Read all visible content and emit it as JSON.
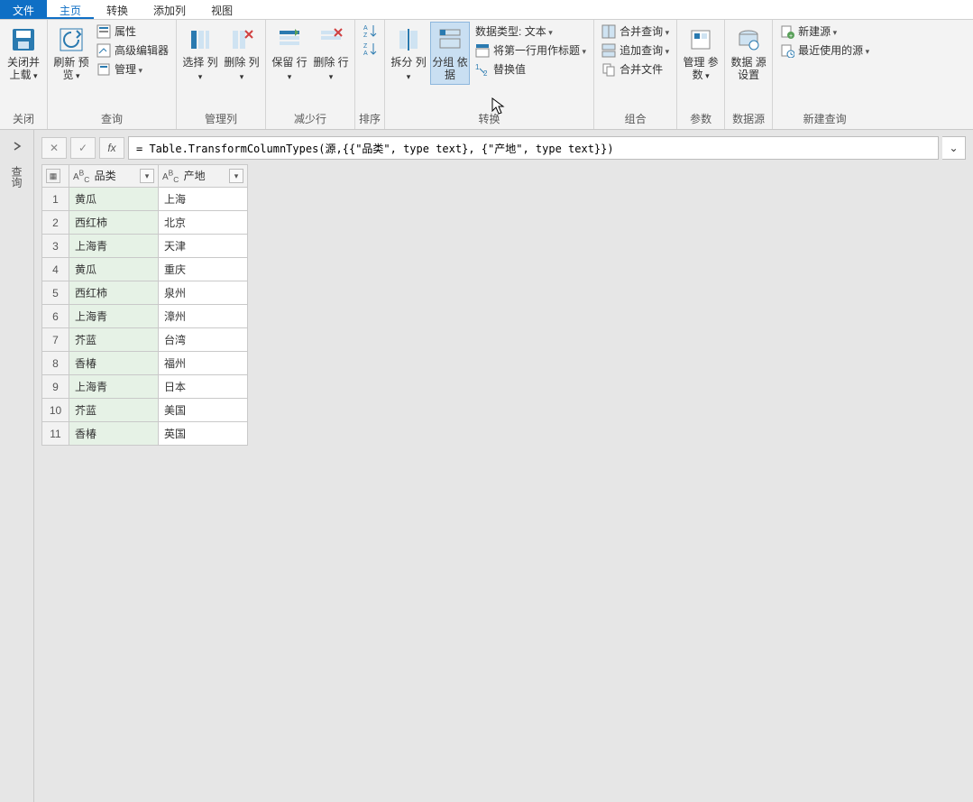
{
  "tabs": {
    "file": "文件",
    "home": "主页",
    "transform": "转换",
    "add_column": "添加列",
    "view": "视图"
  },
  "ribbon": {
    "close": {
      "close_load": "关闭并\n上载",
      "group": "关闭"
    },
    "query": {
      "refresh": "刷新\n预览",
      "properties": "属性",
      "adv_editor": "高级编辑器",
      "manage": "管理",
      "group": "查询"
    },
    "manage_cols": {
      "choose": "选择\n列",
      "remove": "删除\n列",
      "group": "管理列"
    },
    "reduce_rows": {
      "keep": "保留\n行",
      "remove": "删除\n行",
      "group": "减少行"
    },
    "sort": {
      "group": "排序"
    },
    "split_group": {
      "split": "拆分\n列",
      "groupby": "分组\n依据",
      "group": "转换"
    },
    "transform": {
      "datatype_label": "数据类型:",
      "datatype_value": "文本",
      "first_row": "将第一行用作标题",
      "replace": "替换值"
    },
    "combine": {
      "merge": "合并查询",
      "append": "追加查询",
      "combine_files": "合并文件",
      "group": "组合"
    },
    "params": {
      "label": "管理\n参数",
      "group": "参数"
    },
    "datasource": {
      "label": "数据\n源设置",
      "group": "数据源"
    },
    "newquery": {
      "new_source": "新建源",
      "recent": "最近使用的源",
      "group": "新建查询"
    }
  },
  "rail": {
    "label": "查询"
  },
  "formula": {
    "text": "= Table.TransformColumnTypes(源,{{\"品类\", type text}, {\"产地\", type text}})"
  },
  "columns": [
    "品类",
    "产地"
  ],
  "rows": [
    {
      "n": "1",
      "c0": "黄瓜",
      "c1": "上海"
    },
    {
      "n": "2",
      "c0": "西红柿",
      "c1": "北京"
    },
    {
      "n": "3",
      "c0": "上海青",
      "c1": "天津"
    },
    {
      "n": "4",
      "c0": "黄瓜",
      "c1": "重庆"
    },
    {
      "n": "5",
      "c0": "西红柿",
      "c1": "泉州"
    },
    {
      "n": "6",
      "c0": "上海青",
      "c1": "漳州"
    },
    {
      "n": "7",
      "c0": "芥蓝",
      "c1": "台湾"
    },
    {
      "n": "8",
      "c0": "香椿",
      "c1": "福州"
    },
    {
      "n": "9",
      "c0": "上海青",
      "c1": "日本"
    },
    {
      "n": "10",
      "c0": "芥蓝",
      "c1": "美国"
    },
    {
      "n": "11",
      "c0": "香椿",
      "c1": "英国"
    }
  ]
}
